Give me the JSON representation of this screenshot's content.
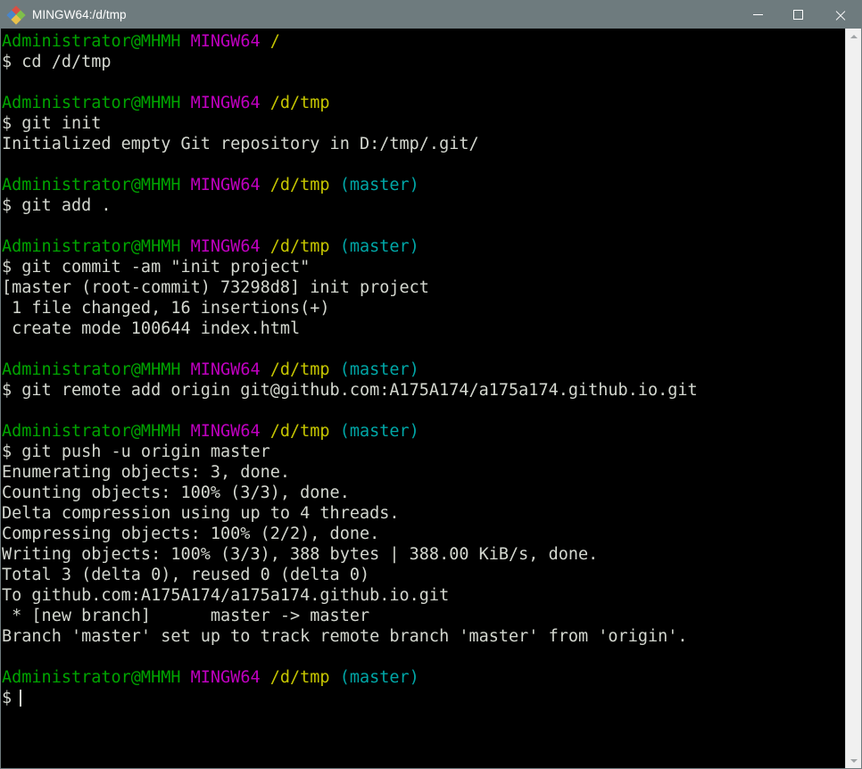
{
  "window": {
    "title": "MINGW64:/d/tmp",
    "icon": "mingw-diamond-icon",
    "background_color": "#000000",
    "titlebar_color": "#6e7b7e",
    "controls": {
      "minimize_label": "Minimize",
      "maximize_label": "Maximize",
      "close_label": "Close"
    }
  },
  "colors": {
    "user": "#00a400",
    "system": "#bf00bf",
    "path": "#c5c500",
    "branch": "#00a6a6",
    "output": "#d3d7cf"
  },
  "prompt": {
    "user_host": "Administrator@MHMH",
    "system": "MINGW64",
    "sigil": "$"
  },
  "terminal": {
    "lines": [
      {
        "type": "prompt",
        "user": "Administrator@MHMH",
        "system": "MINGW64",
        "path": "/",
        "branch": ""
      },
      {
        "type": "command",
        "text": "$ cd /d/tmp"
      },
      {
        "type": "blank",
        "text": ""
      },
      {
        "type": "prompt",
        "user": "Administrator@MHMH",
        "system": "MINGW64",
        "path": "/d/tmp",
        "branch": ""
      },
      {
        "type": "command",
        "text": "$ git init"
      },
      {
        "type": "output",
        "text": "Initialized empty Git repository in D:/tmp/.git/"
      },
      {
        "type": "blank",
        "text": ""
      },
      {
        "type": "prompt",
        "user": "Administrator@MHMH",
        "system": "MINGW64",
        "path": "/d/tmp",
        "branch": "(master)"
      },
      {
        "type": "command",
        "text": "$ git add ."
      },
      {
        "type": "blank",
        "text": ""
      },
      {
        "type": "prompt",
        "user": "Administrator@MHMH",
        "system": "MINGW64",
        "path": "/d/tmp",
        "branch": "(master)"
      },
      {
        "type": "command",
        "text": "$ git commit -am \"init project\""
      },
      {
        "type": "output",
        "text": "[master (root-commit) 73298d8] init project"
      },
      {
        "type": "output",
        "text": " 1 file changed, 16 insertions(+)"
      },
      {
        "type": "output",
        "text": " create mode 100644 index.html"
      },
      {
        "type": "blank",
        "text": ""
      },
      {
        "type": "prompt",
        "user": "Administrator@MHMH",
        "system": "MINGW64",
        "path": "/d/tmp",
        "branch": "(master)"
      },
      {
        "type": "command",
        "text": "$ git remote add origin git@github.com:A175A174/a175a174.github.io.git"
      },
      {
        "type": "blank",
        "text": ""
      },
      {
        "type": "prompt",
        "user": "Administrator@MHMH",
        "system": "MINGW64",
        "path": "/d/tmp",
        "branch": "(master)"
      },
      {
        "type": "command",
        "text": "$ git push -u origin master"
      },
      {
        "type": "output",
        "text": "Enumerating objects: 3, done."
      },
      {
        "type": "output",
        "text": "Counting objects: 100% (3/3), done."
      },
      {
        "type": "output",
        "text": "Delta compression using up to 4 threads."
      },
      {
        "type": "output",
        "text": "Compressing objects: 100% (2/2), done."
      },
      {
        "type": "output",
        "text": "Writing objects: 100% (3/3), 388 bytes | 388.00 KiB/s, done."
      },
      {
        "type": "output",
        "text": "Total 3 (delta 0), reused 0 (delta 0)"
      },
      {
        "type": "output",
        "text": "To github.com:A175A174/a175a174.github.io.git"
      },
      {
        "type": "output",
        "text": " * [new branch]      master -> master"
      },
      {
        "type": "output",
        "text": "Branch 'master' set up to track remote branch 'master' from 'origin'."
      },
      {
        "type": "blank",
        "text": ""
      },
      {
        "type": "prompt",
        "user": "Administrator@MHMH",
        "system": "MINGW64",
        "path": "/d/tmp",
        "branch": "(master)"
      },
      {
        "type": "cursor-line",
        "text": "$"
      }
    ]
  },
  "scrollbar": {
    "up_arrow": "chevron-up-icon",
    "down_arrow": "chevron-down-icon",
    "thumb_top_pct": 0,
    "thumb_height_pct": 100
  }
}
